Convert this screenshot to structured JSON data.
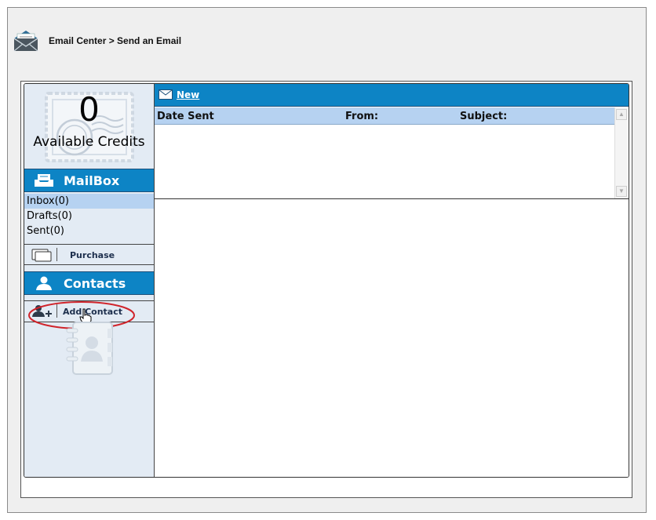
{
  "header": {
    "title": "Email Center > Send an Email",
    "icon": "email-envelope-icon"
  },
  "credits": {
    "count": "0",
    "label": "Available Credits"
  },
  "mailbox": {
    "title": "MailBox",
    "icon": "inbox-tray-icon",
    "items": [
      {
        "label": "Inbox(0)",
        "selected": true
      },
      {
        "label": "Drafts(0)",
        "selected": false
      },
      {
        "label": "Sent(0)",
        "selected": false
      }
    ]
  },
  "purchase": {
    "label": "Purchase",
    "icon": "cards-icon"
  },
  "contacts": {
    "title": "Contacts",
    "icon": "person-icon",
    "add_label": "Add Contact",
    "add_icon": "add-person-icon"
  },
  "toolbar": {
    "new_label": "New",
    "new_icon": "envelope-icon"
  },
  "list": {
    "columns": [
      "Date Sent",
      "From:",
      "Subject:"
    ],
    "rows": []
  },
  "colors": {
    "accent_blue": "#0d84c5",
    "header_light_blue": "#b6d2f1",
    "sidebar_bg": "#e3ebf4",
    "highlight_red": "#d0242b"
  }
}
